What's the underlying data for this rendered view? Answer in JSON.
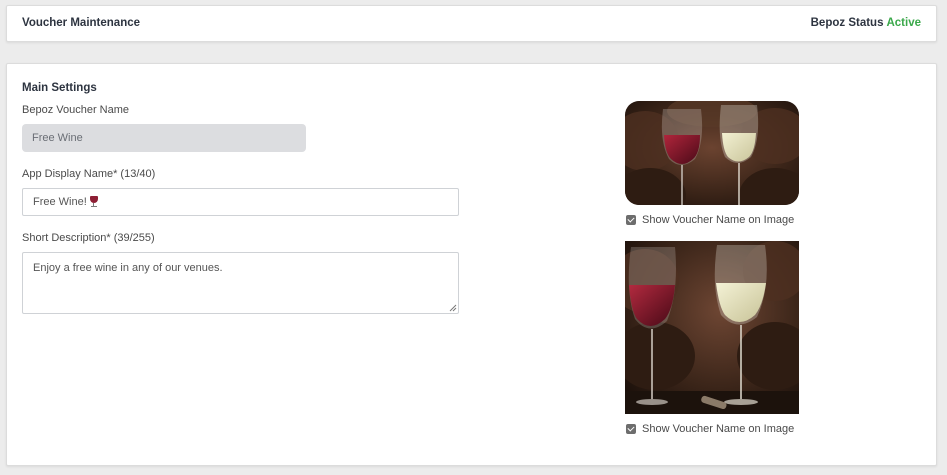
{
  "header": {
    "title": "Voucher Maintenance",
    "status_label": "Bepoz Status",
    "status_value": "Active"
  },
  "main": {
    "section_title": "Main Settings",
    "voucher_name": {
      "label": "Bepoz Voucher Name",
      "value": "Free Wine"
    },
    "display_name": {
      "label": "App Display Name* (13/40)",
      "value": "Free Wine!"
    },
    "short_description": {
      "label": "Short Description* (39/255)",
      "value": "Enjoy a free wine in any of our venues."
    }
  },
  "images": [
    {
      "icon": "wine-glasses-image",
      "checkbox_label": "Show Voucher Name on Image",
      "checked": true
    },
    {
      "icon": "wine-glasses-image",
      "checkbox_label": "Show Voucher Name on Image",
      "checked": true
    }
  ],
  "colors": {
    "status_active": "#3aa84a",
    "heading": "#2d3440"
  }
}
